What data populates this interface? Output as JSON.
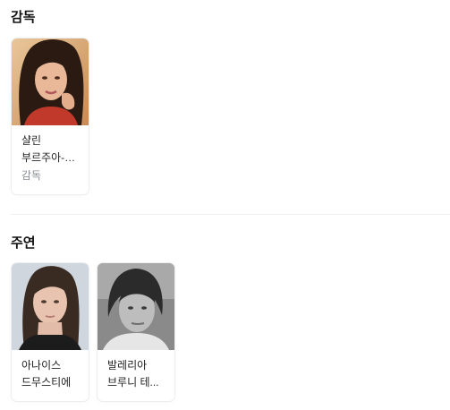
{
  "director_section": {
    "title": "감독",
    "people": [
      {
        "name": "샬린 부르주아-타케...",
        "role": "감독",
        "photo": "director-portrait"
      }
    ]
  },
  "cast_section": {
    "title": "주연",
    "people": [
      {
        "name": "아나이스 드무스티에",
        "photo": "actor-portrait-1"
      },
      {
        "name": "발레리아 브루니 테...",
        "photo": "actor-portrait-2"
      }
    ]
  }
}
